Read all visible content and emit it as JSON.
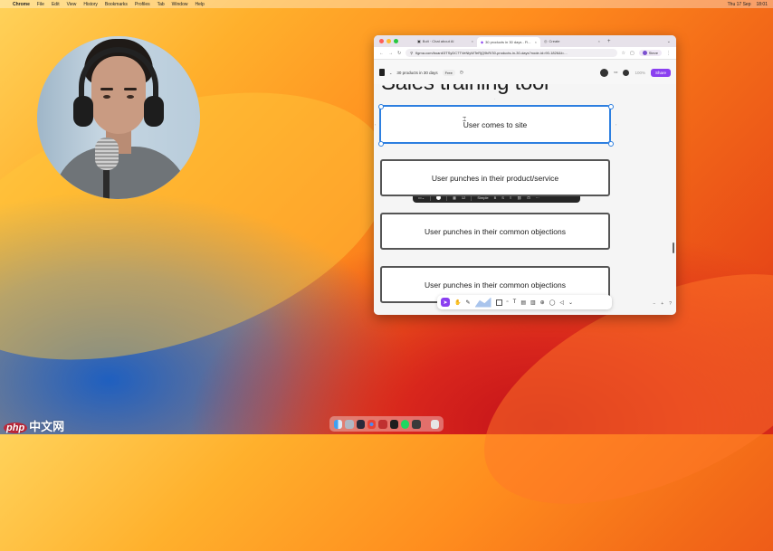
{
  "menubar": {
    "apple": "",
    "items": [
      "Chrome",
      "File",
      "Edit",
      "View",
      "History",
      "Bookmarks",
      "Profiles",
      "Tab",
      "Window",
      "Help"
    ],
    "right": [
      "",
      "",
      "",
      "Thu 17 Sep",
      "18:01"
    ]
  },
  "browser": {
    "tabs": [
      {
        "label": "Bolt · Chat about AI"
      },
      {
        "label": "30 products in 30 days - Fi..."
      },
      {
        "label": "Create"
      }
    ],
    "new_tab": "+",
    "url": "figma.com/board/3TSyDC7TVeNlyWTeRjQ9kR/30-products-in-30-days?node-id=90-1826&t=...",
    "profile": "Steve"
  },
  "figma": {
    "file_name": "30 products in 30 days",
    "badge": "Free",
    "zoom": "100%",
    "share": "Share"
  },
  "canvas": {
    "title": "Sales training tool",
    "cards": [
      "User comes to site",
      "User punches in their product/service",
      "User punches in their common objections",
      "User punches in their common objections"
    ],
    "context_toolbar": {
      "text_size": "Simple",
      "font": "12"
    }
  },
  "colors": {
    "accent": "#8a3ff0",
    "selection": "#2d7fe0"
  }
}
